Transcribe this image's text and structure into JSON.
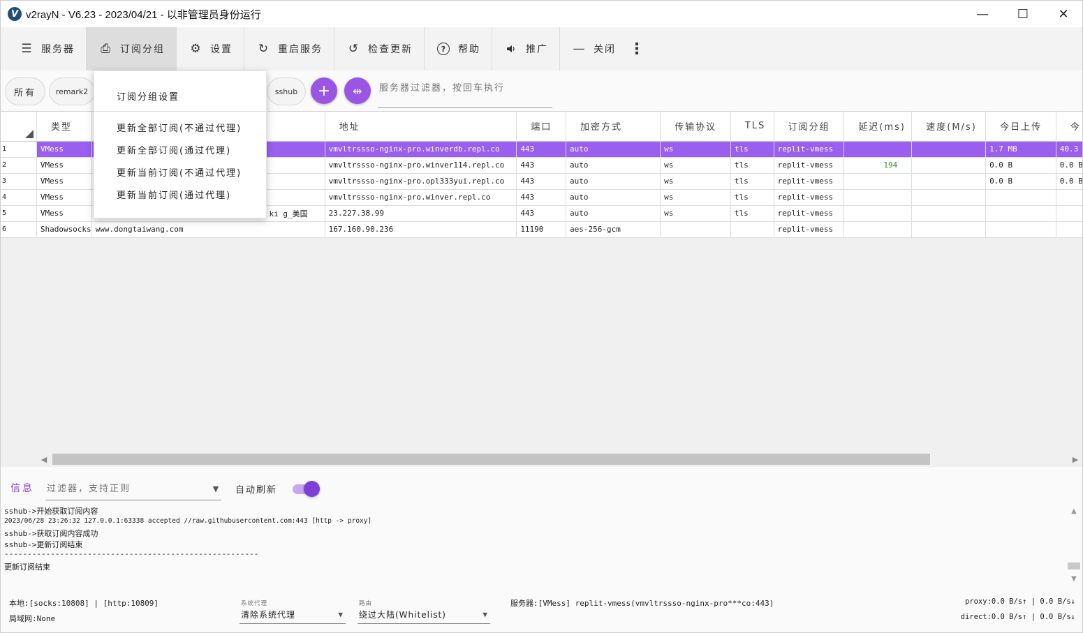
{
  "window": {
    "title": "v2rayN - V6.23 - 2023/04/21 - 以非管理员身份运行",
    "minimize": "—",
    "maximize": "☐",
    "close": "✕"
  },
  "toolbar": {
    "items": [
      {
        "label": "服务器",
        "icon": "server-icon",
        "glyph": "☰"
      },
      {
        "label": "订阅分组",
        "icon": "subscription-icon",
        "glyph": "⎙"
      },
      {
        "label": "设置",
        "icon": "gear-icon",
        "glyph": "⚙"
      },
      {
        "label": "重启服务",
        "icon": "restart-icon",
        "glyph": "↻"
      },
      {
        "label": "检查更新",
        "icon": "update-icon",
        "glyph": "↺"
      },
      {
        "label": "帮助",
        "icon": "help-icon",
        "glyph": "?"
      },
      {
        "label": "推广",
        "icon": "speaker-icon",
        "glyph": "🔈"
      },
      {
        "label": "关闭",
        "icon": "minus-icon",
        "glyph": "—"
      }
    ],
    "more": "⋮"
  },
  "subscription_menu": {
    "settings": "订阅分组设置",
    "items": [
      "更新全部订阅(不通过代理)",
      "更新全部订阅(通过代理)",
      "更新当前订阅(不通过代理)",
      "更新当前订阅(通过代理)"
    ]
  },
  "chips": {
    "all": "所有",
    "remark2": "remark2",
    "sshub": "sshub",
    "add": "+",
    "split": "⇹"
  },
  "server_filter": {
    "placeholder": "服务器过滤器，按回车执行"
  },
  "grid": {
    "columns": [
      "类型",
      "",
      "地址",
      "端口",
      "加密方式",
      "传输协议",
      "TLS",
      "订阅分组",
      "延迟(ms)",
      "速度(M/s)",
      "今日上传",
      "今"
    ],
    "rows": [
      {
        "num": "1",
        "type": "VMess",
        "remarks": "",
        "address": "vmvltrssso-nginx-pro.winverdb.repl.co",
        "port": "443",
        "security": "auto",
        "network": "ws",
        "tls": "tls",
        "sub": "replit-vmess",
        "delay": "",
        "speed": "",
        "up": "1.7 MB",
        "today": "40.3"
      },
      {
        "num": "2",
        "type": "VMess",
        "remarks": "",
        "address": "vmvltrssso-nginx-pro.winver114.repl.co",
        "port": "443",
        "security": "auto",
        "network": "ws",
        "tls": "tls",
        "sub": "replit-vmess",
        "delay": "194",
        "speed": "",
        "up": "0.0 B",
        "today": "0.0 B"
      },
      {
        "num": "3",
        "type": "VMess",
        "remarks": "",
        "address": "vmvltrssso-nginx-pro.opl333yui.repl.co",
        "port": "443",
        "security": "auto",
        "network": "ws",
        "tls": "tls",
        "sub": "replit-vmess",
        "delay": "",
        "speed": "",
        "up": "0.0 B",
        "today": "0.0 B"
      },
      {
        "num": "4",
        "type": "VMess",
        "remarks": "",
        "address": "vmvltrssso-nginx-pro.winver.repl.co",
        "port": "443",
        "security": "auto",
        "network": "ws",
        "tls": "tls",
        "sub": "replit-vmess",
        "delay": "",
        "speed": "",
        "up": "",
        "today": ""
      },
      {
        "num": "5",
        "type": "VMess",
        "remarks": "ki g_美国",
        "address": "23.227.38.99",
        "port": "443",
        "security": "auto",
        "network": "ws",
        "tls": "tls",
        "sub": "replit-vmess",
        "delay": "",
        "speed": "",
        "up": "",
        "today": ""
      },
      {
        "num": "6",
        "type": "Shadowsocks",
        "remarks": "www.dongtaiwang.com",
        "address": "167.160.90.236",
        "port": "11190",
        "security": "aes-256-gcm",
        "network": "",
        "tls": "",
        "sub": "replit-vmess",
        "delay": "",
        "speed": "",
        "up": "",
        "today": ""
      }
    ]
  },
  "log": {
    "tab": "信息",
    "filter_placeholder": "过滤器，支持正则",
    "auto_refresh": "自动刷新",
    "lines": [
      "sshub->开始获取订阅内容",
      "2023/06/28 23:26:32 127.0.0.1:63338 accepted //raw.githubusercontent.com:443 [http -> proxy]",
      "sshub->获取订阅内容成功",
      "sshub->更新订阅结束",
      "-------------------------------------------------------",
      "更新订阅结束"
    ]
  },
  "status": {
    "local": "本地:[socks:10808] | [http:10809]",
    "lan": "局域网:None",
    "sysproxy_label": "系统代理",
    "sysproxy_value": "清除系统代理",
    "routing_label": "路由",
    "routing_value": "绕过大陆(Whitelist)",
    "server": "服务器:[VMess] replit-vmess(vmvltrssso-nginx-pro***co:443)",
    "proxy_speed": "proxy:0.0 B/s↑ | 0.0 B/s↓",
    "direct_speed": "direct:0.0 B/s↑ | 0.0 B/s↓"
  },
  "colors": {
    "accent": "#9b55e5",
    "selected_row": "#9b5ff0",
    "delay_ok": "#2f8a2f"
  }
}
